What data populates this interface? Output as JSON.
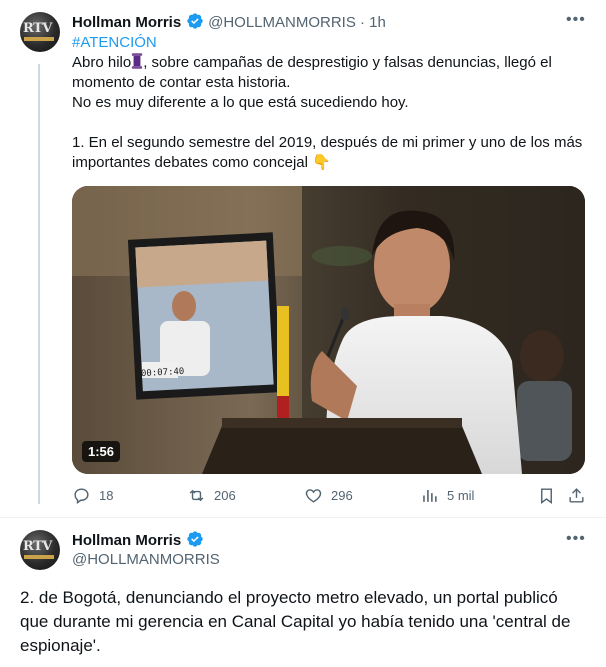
{
  "tweet1": {
    "author_name": "Hollman Morris",
    "handle_time": "@HOLLMANMORRIS · 1h",
    "hashtag": "#ATENCIÓN",
    "line1a": "Abro hilo",
    "line1b": ", sobre campañas de desprestigio y falsas denuncias, llegó el",
    "line2": "momento de contar esta historia.",
    "line3": "No es muy diferente a lo que está sucediendo hoy.",
    "line4": "1. En el segundo semestre del 2019, después de mi primer y uno de los más",
    "line5a": "importantes debates como concejal",
    "point_emoji": "👇",
    "video_duration": "1:56",
    "screen_timer": "00:07:40",
    "replies": "18",
    "reposts": "206",
    "likes": "296",
    "views": "5 mil"
  },
  "tweet2": {
    "author_name": "Hollman Morris",
    "handle": "@HOLLMANMORRIS",
    "line1": "2. de Bogotá, denunciando el proyecto metro elevado, un portal publicó",
    "line2": "que durante mi gerencia en Canal Capital yo había tenido una 'central de",
    "line3": "espionaje'."
  },
  "avatar_text": "RTV",
  "colors": {
    "accent": "#1d9bf0",
    "muted": "#536471",
    "text": "#0f1419"
  }
}
